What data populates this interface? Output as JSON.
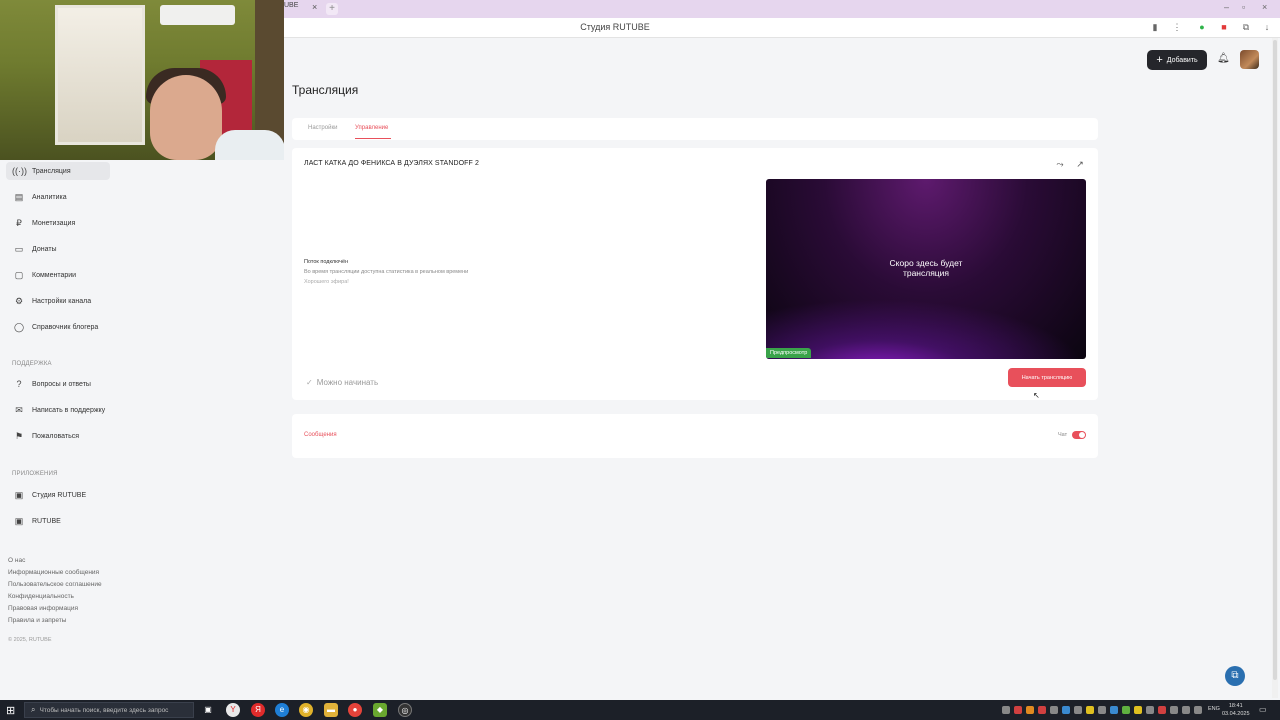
{
  "browser": {
    "tab_title": "UBE",
    "page_title": "Студия RUTUBE"
  },
  "header": {
    "add_label": "Добавить"
  },
  "sidebar": {
    "items": [
      {
        "label": "Трансляция",
        "icon": "broadcast-icon",
        "active": true
      },
      {
        "label": "Аналитика",
        "icon": "analytics-icon",
        "active": false
      },
      {
        "label": "Монетизация",
        "icon": "monetization-icon",
        "active": false
      },
      {
        "label": "Донаты",
        "icon": "donations-icon",
        "active": false
      },
      {
        "label": "Комментарии",
        "icon": "comments-icon",
        "active": false
      },
      {
        "label": "Настройки канала",
        "icon": "gear-icon",
        "active": false
      },
      {
        "label": "Справочник блогера",
        "icon": "help-circle-icon",
        "active": false
      }
    ],
    "support_label": "ПОДДЕРЖКА",
    "support_items": [
      {
        "label": "Вопросы и ответы",
        "icon": "question-icon"
      },
      {
        "label": "Написать в поддержку",
        "icon": "mail-icon"
      },
      {
        "label": "Пожаловаться",
        "icon": "flag-icon"
      }
    ],
    "apps_label": "ПРИЛОЖЕНИЯ",
    "app_items": [
      {
        "label": "Студия RUTUBE",
        "icon": "app-icon"
      },
      {
        "label": "RUTUBE",
        "icon": "app-icon"
      }
    ],
    "footer_links": [
      "О нас",
      "Информационные сообщения",
      "Пользовательское соглашение",
      "Конфиденциальность",
      "Правовая информация",
      "Правила и запреты"
    ],
    "copyright": "© 2025, RUTUBE"
  },
  "main": {
    "title": "Трансляция",
    "tabs": [
      {
        "label": "Настройки",
        "active": false
      },
      {
        "label": "Управление",
        "active": true
      }
    ],
    "stream_title": "ЛАСТ КАТКА ДО ФЕНИКСА В ДУЭЛЯХ STANDOFF 2",
    "status_title": "Поток подключён",
    "status_desc": "Во время трансляции доступна статистика в реальном времени",
    "status_wish": "Хорошего эфира!",
    "preview_text": "Скоро здесь будет\nтрансляция",
    "preview_badge": "Предпросмотр",
    "ready_label": "Можно начинать",
    "start_button": "Начать трансляцию",
    "messages_label": "Сообщения",
    "chat_label": "Чат",
    "chat_enabled": true
  },
  "taskbar": {
    "search_placeholder": "Чтобы начать поиск, введите здесь запрос",
    "lang": "ENG",
    "time": "18:41",
    "date": "03.04.2025"
  },
  "colors": {
    "accent": "#e8505b",
    "dark_button": "#25262b",
    "preview_badge": "#3aa34a"
  }
}
